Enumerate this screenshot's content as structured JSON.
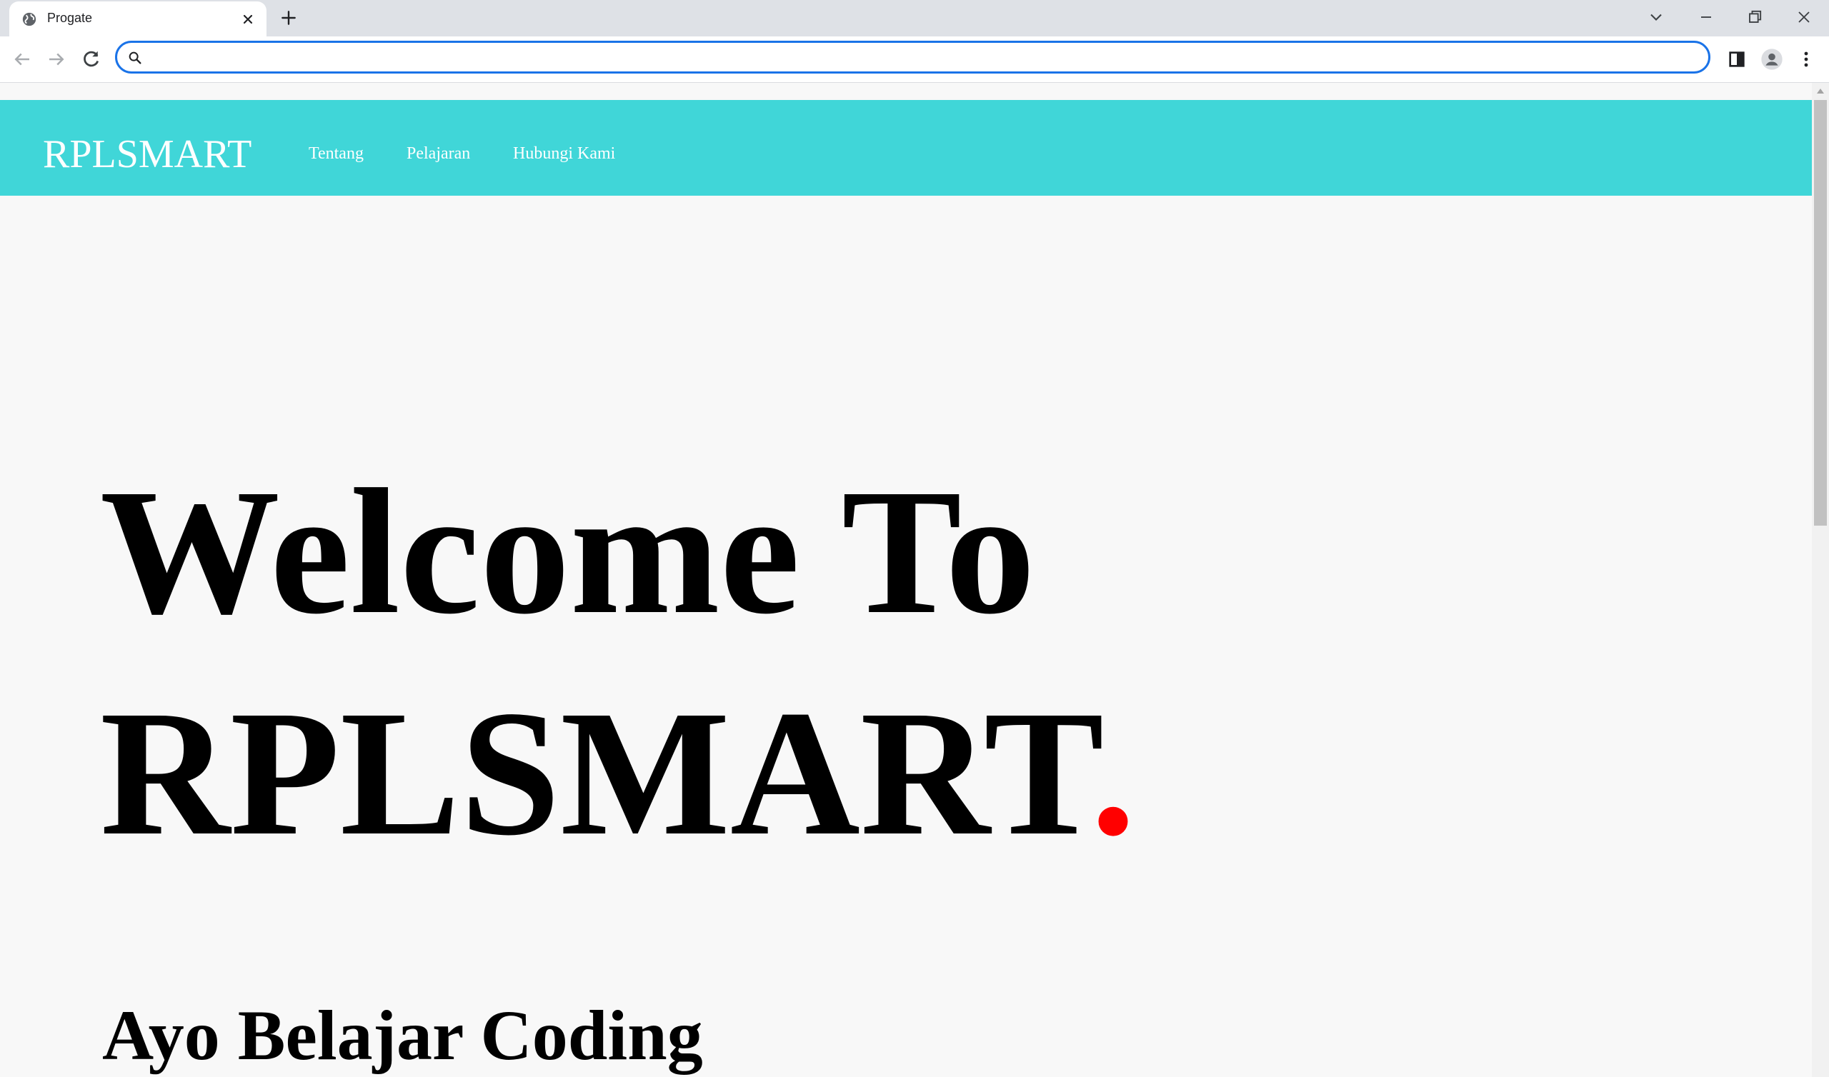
{
  "browser": {
    "tab_title": "Progate",
    "address_placeholder": "",
    "address_value": ""
  },
  "site": {
    "logo": "RPLSMART",
    "nav": [
      "Tentang",
      "Pelajaran",
      "Hubungi Kami"
    ]
  },
  "hero": {
    "line1": "Welcome To",
    "line2": "RPLSMART",
    "accent": ".",
    "subheading": "Ayo Belajar Coding"
  },
  "colors": {
    "header_bg": "#40d6d8",
    "accent_dot": "#ff0000",
    "page_bg": "#f8f8f8",
    "focus_ring": "#1a73e8"
  }
}
